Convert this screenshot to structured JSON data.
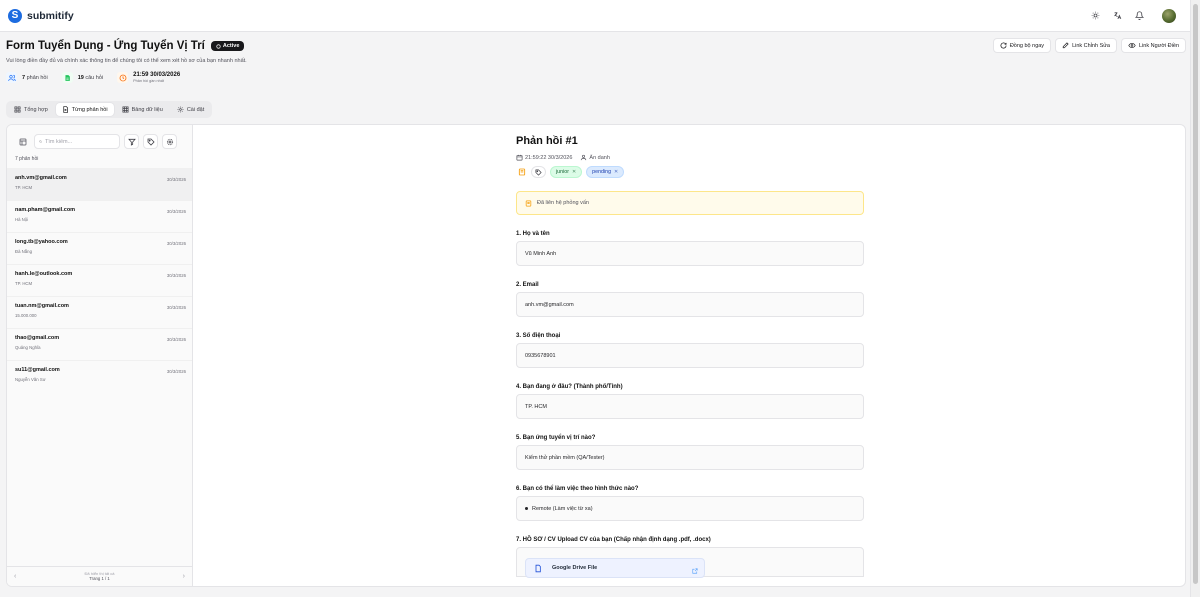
{
  "app": {
    "name": "submitify",
    "brand_color": "#1d6ce0"
  },
  "form": {
    "title": "Form Tuyển Dụng - Ứng Tuyển Vị Trí",
    "status": "Active",
    "description": "Vui lòng điền đầy đủ và chính xác thông tin để chúng tôi có thể xem xét hồ sơ của bạn nhanh nhất."
  },
  "actions": {
    "sync": "Đồng bộ ngay",
    "edit_link": "Link Chỉnh Sửa",
    "respondent_link": "Link Người Điền"
  },
  "stats": {
    "responses_count": "7",
    "responses_label": "phản hồi",
    "questions_count": "19",
    "questions_label": "câu hỏi",
    "last_time": "21:59 30/03/2026",
    "last_time_label": "Phản hồi gần nhất"
  },
  "tabs": [
    {
      "label": "Tổng hợp",
      "icon": "grid-icon"
    },
    {
      "label": "Từng phản hồi",
      "icon": "document-icon",
      "active": true
    },
    {
      "label": "Bảng dữ liệu",
      "icon": "table-icon"
    },
    {
      "label": "Cài đặt",
      "icon": "gear-icon"
    }
  ],
  "list": {
    "search_placeholder": "Tìm kiếm...",
    "count_label": "7 phản hồi",
    "items": [
      {
        "email": "anh.vm@gmail.com",
        "date": "30/3/2026",
        "sub": "TP. HCM"
      },
      {
        "email": "nam.pham@gmail.com",
        "date": "30/3/2026",
        "sub": "Hà Nội"
      },
      {
        "email": "long.tb@yahoo.com",
        "date": "30/3/2026",
        "sub": "Đà Nẵng"
      },
      {
        "email": "hanh.le@outlook.com",
        "date": "30/3/2026",
        "sub": "TP. HCM"
      },
      {
        "email": "tuan.nm@gmail.com",
        "date": "30/3/2026",
        "sub": "15.000.000"
      },
      {
        "email": "thao@gmail.com",
        "date": "30/3/2026",
        "sub": "Quảng Nghĩa"
      },
      {
        "email": "su11@gmail.com",
        "date": "30/3/2026",
        "sub": "Nguyễn Văn Sư"
      }
    ],
    "pager_top": "Đã hiển thị tất cả",
    "pager_bottom": "Trang 1 / 1"
  },
  "detail": {
    "title": "Phản hồi #1",
    "timestamp": "21:59:22 30/3/2026",
    "author": "Ẩn danh",
    "tags": [
      {
        "label": "junior",
        "color": "#166534"
      },
      {
        "label": "pending",
        "color": "#1e40af"
      }
    ],
    "note": "Đã liên hệ phỏng vấn",
    "questions": [
      {
        "label": "1. Họ và tên",
        "value": "Vũ Minh Anh"
      },
      {
        "label": "2. Email",
        "value": "anh.vm@gmail.com"
      },
      {
        "label": "3. Số điện thoại",
        "value": "0935678901"
      },
      {
        "label": "4. Bạn đang ở đâu? (Thành phố/Tỉnh)",
        "value": "TP. HCM"
      },
      {
        "label": "5. Bạn ứng tuyển vị trí nào?",
        "value": "Kiểm thử phần mềm (QA/Tester)"
      },
      {
        "label": "6. Bạn có thể làm việc theo hình thức nào?",
        "value": "Remote (Làm việc từ xa)"
      }
    ],
    "upload_label": "7. HỒ SƠ / CV Upload CV của bạn (Chấp nhận định dạng .pdf, .docx)",
    "file_name": "Google Drive File"
  }
}
